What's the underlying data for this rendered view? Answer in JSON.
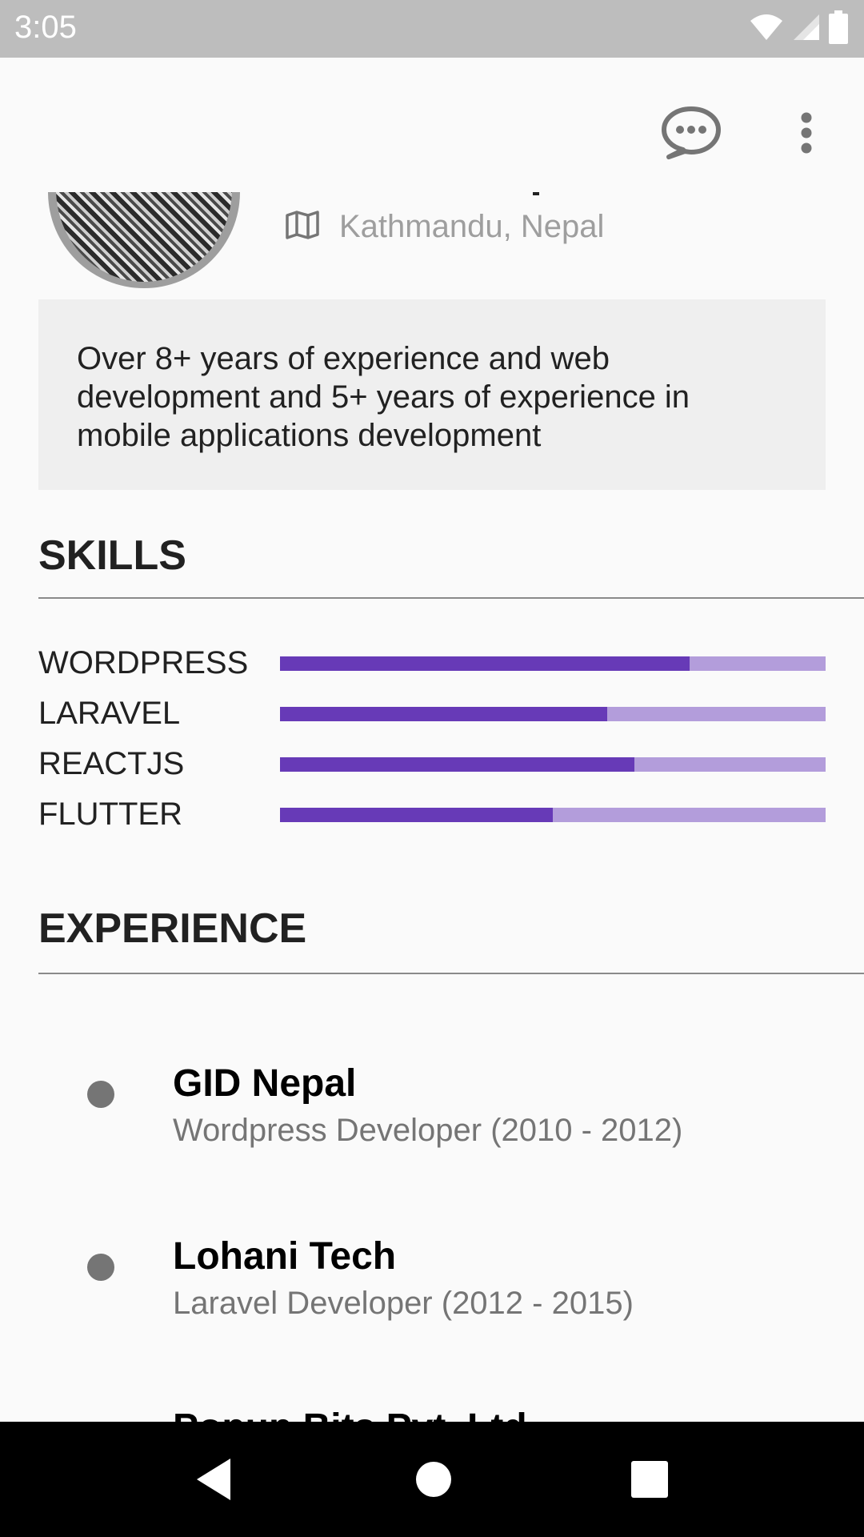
{
  "status_bar": {
    "time": "3:05"
  },
  "app_bar": {
    "icons": [
      "chat-bubble-icon",
      "more-vert-icon"
    ]
  },
  "profile": {
    "location": "Kathmandu, Nepal",
    "summary": "Over 8+ years of experience and web development and 5+ years of experience in mobile applications development"
  },
  "skills": {
    "title": "SKILLS",
    "items": [
      {
        "label": "WORDPRESS",
        "level": 0.75
      },
      {
        "label": "LARAVEL",
        "level": 0.6
      },
      {
        "label": "REACTJS",
        "level": 0.65
      },
      {
        "label": "FLUTTER",
        "level": 0.5
      }
    ]
  },
  "experience": {
    "title": "EXPERIENCE",
    "items": [
      {
        "company": "GID Nepal",
        "role": "Wordpress Developer (2010 - 2012)"
      },
      {
        "company": "Lohani Tech",
        "role": "Laravel Developer (2012 - 2015)"
      },
      {
        "company": "Popup Bits Pvt. Ltd.",
        "role": ""
      }
    ]
  },
  "colors": {
    "accent": "#673ab7",
    "accent_light": "#b39ddb",
    "status_bar": "#bdbdbd"
  }
}
